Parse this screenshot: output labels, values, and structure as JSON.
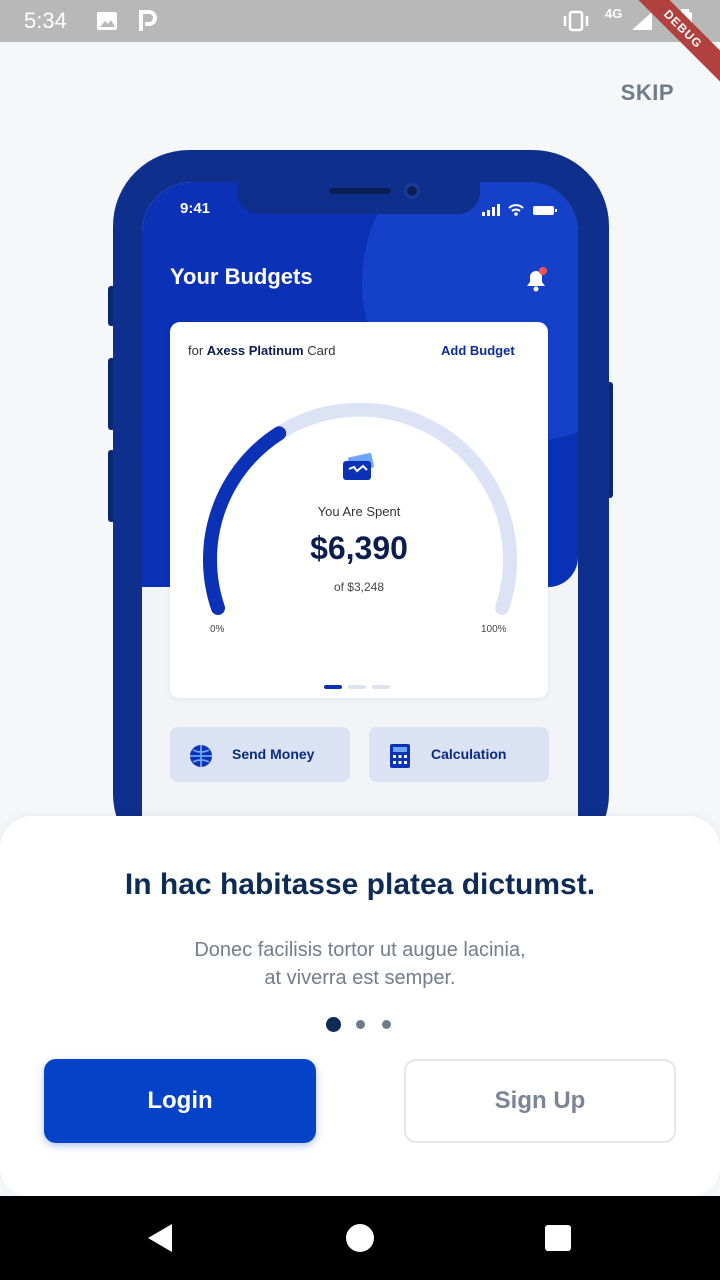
{
  "status_bar": {
    "time": "5:34",
    "network": "4G",
    "debug_label": "DEBUG",
    "icons": [
      "image-icon",
      "parking-icon",
      "vibrate-icon",
      "signal-icon",
      "battery-icon"
    ]
  },
  "skip_label": "SKIP",
  "mockup": {
    "time": "9:41",
    "title": "Your Budgets",
    "card": {
      "for_prefix": "for",
      "card_name": "Axess Platinum",
      "card_suffix": "Card",
      "add_label": "Add Budget",
      "spent_label": "You Are Spent",
      "spent_amount": "$6,390",
      "of_amount": "of $3,248",
      "min_label": "0%",
      "max_label": "100%",
      "gauge_fraction": 0.35
    },
    "quick_actions": [
      {
        "label": "Send Money",
        "icon": "globe-icon"
      },
      {
        "label": "Calculation",
        "icon": "calculator-icon"
      }
    ]
  },
  "onboarding": {
    "title": "In hac habitasse platea dictumst.",
    "description_line1": "Donec facilisis tortor ut augue lacinia,",
    "description_line2": "at viverra est semper.",
    "page_count": 3,
    "active_page": 0
  },
  "buttons": {
    "login": "Login",
    "signup": "Sign Up"
  },
  "colors": {
    "primary": "#0442c8",
    "mockup_blue": "#0b31b6",
    "title": "#0d2b55",
    "muted": "#737d8c"
  }
}
